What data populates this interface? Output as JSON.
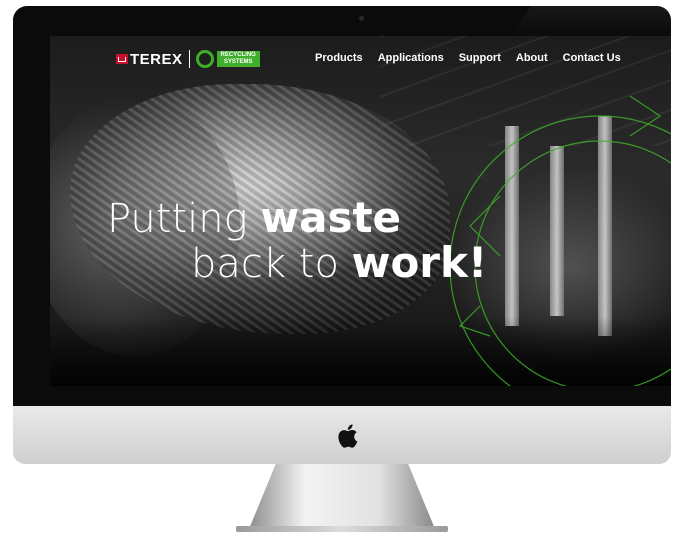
{
  "brand": {
    "company": "TEREX",
    "division_line1": "RECYCLING",
    "division_line2": "SYSTEMS",
    "accent_color": "#3fae2a",
    "brand_red": "#c8102e"
  },
  "nav": {
    "items": [
      {
        "label": "Products"
      },
      {
        "label": "Applications"
      },
      {
        "label": "Support"
      },
      {
        "label": "About"
      },
      {
        "label": "Contact Us"
      }
    ]
  },
  "hero": {
    "line1_light": "Putting",
    "line1_bold": "waste",
    "line2_light": "back to",
    "line2_bold": "work!"
  },
  "device": {
    "logo_icon": "apple-icon"
  }
}
